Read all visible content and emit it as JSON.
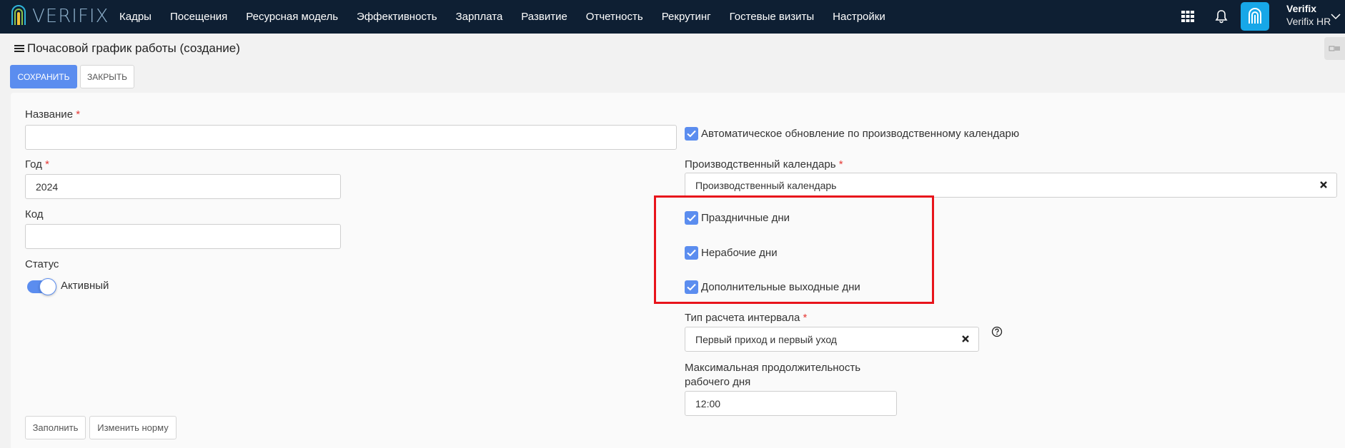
{
  "topbar": {
    "logo_text": "VERIFIX",
    "nav": [
      "Кадры",
      "Посещения",
      "Ресурсная модель",
      "Эффективность",
      "Зарплата",
      "Развитие",
      "Отчетность",
      "Рекрутинг",
      "Гостевые визиты",
      "Настройки"
    ],
    "user_name": "Verifix",
    "user_org": "Verifix HR",
    "colors": {
      "bar": "#0e1f33",
      "brand_tile": "#17a7e8"
    }
  },
  "page": {
    "title": "Почасовой график работы (создание)",
    "save_label": "СОХРАНИТЬ",
    "close_label": "ЗАКРЫТЬ"
  },
  "form": {
    "name": {
      "label": "Название",
      "required_mark": "*",
      "value": ""
    },
    "year": {
      "label": "Год",
      "required_mark": "*",
      "value": "2024"
    },
    "code": {
      "label": "Код",
      "value": ""
    },
    "status": {
      "label": "Статус",
      "value_label": "Активный",
      "on": true
    },
    "auto_update": {
      "label": "Автоматическое обновление по производственному календарю",
      "checked": true
    },
    "prod_calendar": {
      "label": "Производственный календарь",
      "required_mark": "*",
      "value": "Производственный календарь"
    },
    "holidays": {
      "label": "Праздничные дни",
      "checked": true
    },
    "nonworking": {
      "label": "Нерабочие дни",
      "checked": true
    },
    "extra_days_off": {
      "label": "Дополнительные выходные дни",
      "checked": true
    },
    "interval_type": {
      "label": "Тип расчета интервала",
      "required_mark": "*",
      "value": "Первый приход и первый уход"
    },
    "max_duration": {
      "label_line1": "Максимальная продолжительность",
      "label_line2": "рабочего дня",
      "value": "12:00"
    },
    "fill_label": "Заполнить",
    "change_norm_label": "Изменить норму"
  },
  "colors": {
    "primary": "#5b8def",
    "highlight": "#e8141b",
    "required": "#e53935"
  }
}
